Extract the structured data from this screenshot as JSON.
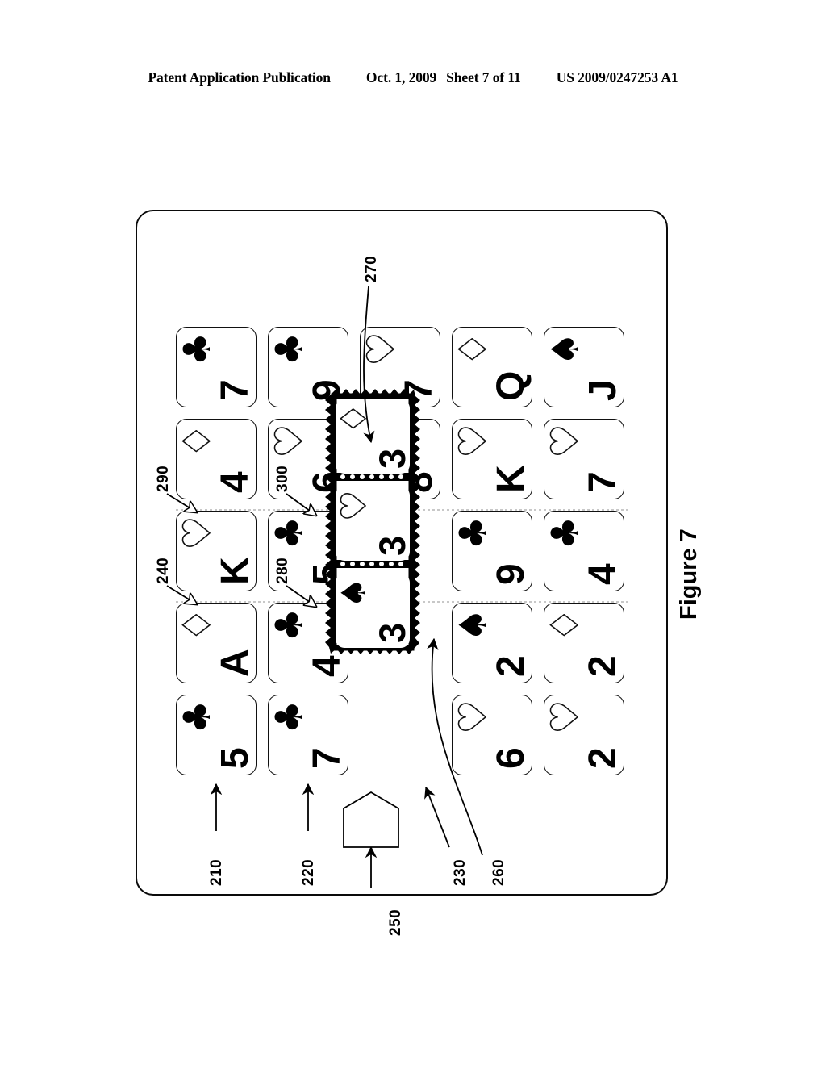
{
  "header": {
    "publication": "Patent Application Publication",
    "date": "Oct. 1, 2009",
    "sheet": "Sheet 7 of 11",
    "patent_number": "US 2009/0247253 A1"
  },
  "figure": {
    "caption": "Figure 7"
  },
  "grid": {
    "rows": 5,
    "columns": 5,
    "cards": [
      {
        "rank": "7",
        "suit": "clubs",
        "glyph": "♣",
        "filled": true,
        "row": 0,
        "col": 0,
        "selected": false
      },
      {
        "rank": "9",
        "suit": "clubs",
        "glyph": "♣",
        "filled": true,
        "row": 0,
        "col": 1,
        "selected": false
      },
      {
        "rank": "7",
        "suit": "hearts",
        "glyph": "♥",
        "filled": false,
        "row": 0,
        "col": 2,
        "selected": false
      },
      {
        "rank": "Q",
        "suit": "diamonds",
        "glyph": "♦",
        "filled": false,
        "row": 0,
        "col": 3,
        "selected": false
      },
      {
        "rank": "J",
        "suit": "spades",
        "glyph": "♠",
        "filled": true,
        "row": 0,
        "col": 4,
        "selected": false
      },
      {
        "rank": "4",
        "suit": "diamonds",
        "glyph": "♦",
        "filled": false,
        "row": 1,
        "col": 0,
        "selected": false
      },
      {
        "rank": "6",
        "suit": "hearts",
        "glyph": "♥",
        "filled": false,
        "row": 1,
        "col": 1,
        "selected": false
      },
      {
        "rank": "8",
        "suit": "clubs",
        "glyph": "♣",
        "filled": true,
        "row": 1,
        "col": 2,
        "selected": false
      },
      {
        "rank": "K",
        "suit": "hearts",
        "glyph": "♥",
        "filled": false,
        "row": 1,
        "col": 3,
        "selected": false
      },
      {
        "rank": "7",
        "suit": "hearts",
        "glyph": "♥",
        "filled": false,
        "row": 1,
        "col": 4,
        "selected": false
      },
      {
        "rank": "K",
        "suit": "hearts",
        "glyph": "♥",
        "filled": false,
        "row": 2,
        "col": 0,
        "selected": false
      },
      {
        "rank": "5",
        "suit": "clubs",
        "glyph": "♣",
        "filled": true,
        "row": 2,
        "col": 1,
        "selected": false
      },
      {
        "rank": "3",
        "suit": "diamonds",
        "glyph": "♦",
        "filled": false,
        "row": 2,
        "col": 2,
        "selected": true
      },
      {
        "rank": "9",
        "suit": "clubs",
        "glyph": "♣",
        "filled": true,
        "row": 2,
        "col": 3,
        "selected": false
      },
      {
        "rank": "4",
        "suit": "clubs",
        "glyph": "♣",
        "filled": true,
        "row": 2,
        "col": 4,
        "selected": false
      },
      {
        "rank": "A",
        "suit": "diamonds",
        "glyph": "♦",
        "filled": false,
        "row": 3,
        "col": 0,
        "selected": false
      },
      {
        "rank": "4",
        "suit": "clubs",
        "glyph": "♣",
        "filled": true,
        "row": 3,
        "col": 1,
        "selected": false
      },
      {
        "rank": "3",
        "suit": "hearts",
        "glyph": "♥",
        "filled": false,
        "row": 3,
        "col": 2,
        "selected": true
      },
      {
        "rank": "2",
        "suit": "spades",
        "glyph": "♠",
        "filled": true,
        "row": 3,
        "col": 3,
        "selected": false
      },
      {
        "rank": "2",
        "suit": "diamonds",
        "glyph": "♦",
        "filled": false,
        "row": 3,
        "col": 4,
        "selected": false
      },
      {
        "rank": "5",
        "suit": "clubs",
        "glyph": "♣",
        "filled": true,
        "row": 4,
        "col": 0,
        "selected": false
      },
      {
        "rank": "7",
        "suit": "clubs",
        "glyph": "♣",
        "filled": true,
        "row": 4,
        "col": 1,
        "selected": false
      },
      {
        "rank": "3",
        "suit": "spades",
        "glyph": "♠",
        "filled": true,
        "row": 4,
        "col": 2,
        "selected": true
      },
      {
        "rank": "6",
        "suit": "hearts",
        "glyph": "♥",
        "filled": false,
        "row": 4,
        "col": 3,
        "selected": false
      },
      {
        "rank": "2",
        "suit": "hearts",
        "glyph": "♥",
        "filled": false,
        "row": 4,
        "col": 4,
        "selected": false
      }
    ]
  },
  "reference_numerals": [
    {
      "id": "210",
      "label": "210",
      "points_to": "card-row-4-col-0"
    },
    {
      "id": "220",
      "label": "220",
      "points_to": "card-row-4-col-1"
    },
    {
      "id": "230",
      "label": "230",
      "points_to": "selection-border"
    },
    {
      "id": "240",
      "label": "240",
      "points_to": "row-separator-left"
    },
    {
      "id": "250",
      "label": "250",
      "points_to": "pentagon-marker"
    },
    {
      "id": "260",
      "label": "260",
      "points_to": "selected-card-3-hearts"
    },
    {
      "id": "270",
      "label": "270",
      "points_to": "selected-card-3-diamonds"
    },
    {
      "id": "280",
      "label": "280",
      "points_to": "column-separator-lower"
    },
    {
      "id": "290",
      "label": "290",
      "points_to": "row-separator-upper-left"
    },
    {
      "id": "300",
      "label": "300",
      "points_to": "column-separator-upper"
    }
  ],
  "colors": {
    "ink": "#000000",
    "paper": "#ffffff",
    "separator": "#9a9a9a"
  }
}
